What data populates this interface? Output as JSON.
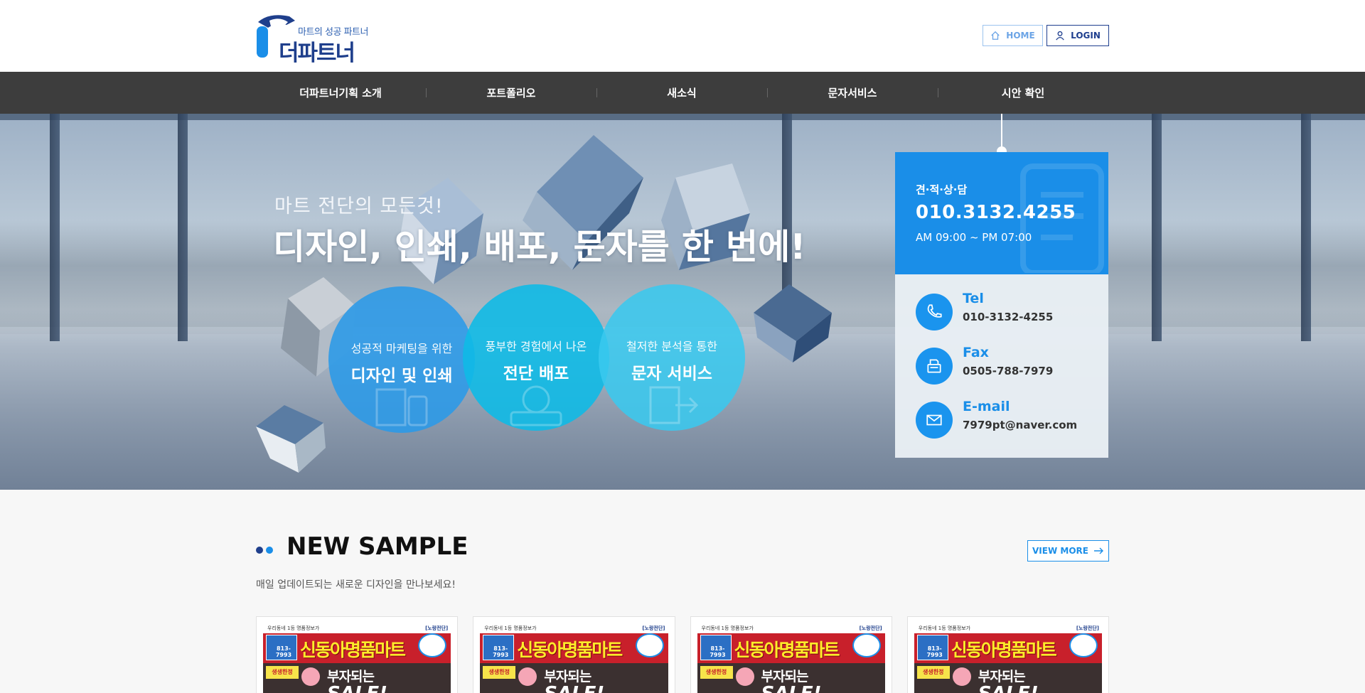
{
  "header": {
    "logo": {
      "subtitle": "마트의 성공 파트너",
      "name": "더파트너"
    },
    "home_label": "HOME",
    "login_label": "LOGIN"
  },
  "nav": {
    "items": [
      {
        "label": "더파트너기획 소개"
      },
      {
        "label": "포트폴리오"
      },
      {
        "label": "새소식"
      },
      {
        "label": "문자서비스"
      },
      {
        "label": "시안 확인"
      }
    ]
  },
  "hero": {
    "subtitle": "마트 전단의 모든것!",
    "title": "디자인, 인쇄, 배포, 문자를 한 번에!",
    "services": [
      {
        "sub": "성공적 마케팅을 위한",
        "main": "디자인 및 인쇄"
      },
      {
        "sub": "풍부한 경험에서 나온",
        "main": "전단 배포"
      },
      {
        "sub": "철저한 분석을 통한",
        "main": "문자 서비스"
      }
    ]
  },
  "contact": {
    "label": "견·적·상·담",
    "phone": "010.3132.4255",
    "hours": "AM 09:00 ~ PM 07:00",
    "rows": [
      {
        "label": "Tel",
        "value": "010-3132-4255",
        "icon": "phone-icon"
      },
      {
        "label": "Fax",
        "value": "0505-788-7979",
        "icon": "fax-icon"
      },
      {
        "label": "E-mail",
        "value": "7979pt@naver.com",
        "icon": "mail-icon"
      }
    ]
  },
  "samples": {
    "title": "NEW SAMPLE",
    "description": "매일 업데이트되는 새로운 디자인을 만나보세요!",
    "view_more_label": "VIEW MORE",
    "cards": [
      {
        "top": "우리동네 1등 명품정보가",
        "tag": "[노랑전단]",
        "side": "813-7993",
        "name": "신동아명품마트",
        "label": "생생한정",
        "slogan": "부자되는",
        "sale": "SALE!"
      },
      {
        "top": "우리동네 1등 명품정보가",
        "tag": "[노랑전단]",
        "side": "813-7993",
        "name": "신동아명품마트",
        "label": "생생한정",
        "slogan": "부자되는",
        "sale": "SALE!"
      },
      {
        "top": "우리동네 1등 명품정보가",
        "tag": "[노랑전단]",
        "side": "813-7993",
        "name": "신동아명품마트",
        "label": "생생한정",
        "slogan": "부자되는",
        "sale": "SALE!"
      },
      {
        "top": "우리동네 1등 명품정보가",
        "tag": "[노랑전단]",
        "side": "813-7993",
        "name": "신동아명품마트",
        "label": "생생한정",
        "slogan": "부자되는",
        "sale": "SALE!"
      }
    ]
  },
  "colors": {
    "brand_navy": "#1f3f8c",
    "accent_blue": "#1a8ee8",
    "nav_bg": "#3d3d3d"
  }
}
